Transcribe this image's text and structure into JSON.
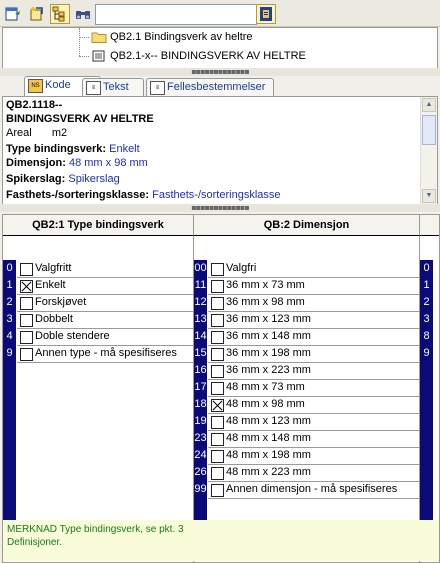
{
  "toolbar": {
    "search_value": "",
    "icons": [
      "new-object-icon",
      "edit-icon",
      "tree-view-icon",
      "binoculars-icon",
      "bookmark-icon"
    ]
  },
  "tree": {
    "items": [
      {
        "label": "QB2.1 Bindingsverk av heltre",
        "icon": "folder-icon"
      },
      {
        "label": "QB2.1-x-- BINDINGSVERK AV HELTRE",
        "icon": "document-icon"
      }
    ]
  },
  "tabs": [
    {
      "label": "Kode",
      "icon": "NS",
      "selected": true
    },
    {
      "label": "Tekst",
      "icon": "doc",
      "selected": false
    },
    {
      "label": "Fellesbestemmelser",
      "icon": "doc",
      "selected": false
    }
  ],
  "info": {
    "code": "QB2.1118--",
    "title": "BINDINGSVERK AV HELTRE",
    "unit_label": "Areal",
    "unit_value": "m2",
    "fields": [
      {
        "label": "Type bindingsverk:",
        "value": "Enkelt"
      },
      {
        "label": "Dimensjon:",
        "value": "48 mm x 98 mm"
      },
      {
        "label": "Spikerslag:",
        "value": "Spikerslag"
      },
      {
        "label": "Fasthets-/sorteringsklasse:",
        "value": "Fasthets-/sorteringsklasse"
      }
    ]
  },
  "columns": [
    {
      "header": "QB2:1 Type bindingsverk",
      "rows": [
        {
          "code": "0",
          "label": "Valgfritt",
          "checked": false
        },
        {
          "code": "1",
          "label": "Enkelt",
          "checked": true
        },
        {
          "code": "2",
          "label": "Forskjøvet",
          "checked": false
        },
        {
          "code": "3",
          "label": "Dobbelt",
          "checked": false
        },
        {
          "code": "4",
          "label": "Doble stendere",
          "checked": false
        },
        {
          "code": "9",
          "label": "Annen type - må spesifiseres",
          "checked": false
        }
      ]
    },
    {
      "header": "QB:2 Dimensjon",
      "rows": [
        {
          "code": "00",
          "label": "Valgfri",
          "checked": false
        },
        {
          "code": "11",
          "label": "36 mm x 73 mm",
          "checked": false
        },
        {
          "code": "12",
          "label": "36 mm x 98 mm",
          "checked": false
        },
        {
          "code": "13",
          "label": "36 mm x 123 mm",
          "checked": false
        },
        {
          "code": "14",
          "label": "36 mm x 148 mm",
          "checked": false
        },
        {
          "code": "15",
          "label": "36 mm x 198 mm",
          "checked": false
        },
        {
          "code": "16",
          "label": "36 mm x 223 mm",
          "checked": false
        },
        {
          "code": "17",
          "label": "48 mm x 73 mm",
          "checked": false
        },
        {
          "code": "18",
          "label": "48 mm x 98 mm",
          "checked": true
        },
        {
          "code": "19",
          "label": "48 mm x 123 mm",
          "checked": false
        },
        {
          "code": "23",
          "label": "48 mm x 148 mm",
          "checked": false
        },
        {
          "code": "24",
          "label": "48 mm x 198 mm",
          "checked": false
        },
        {
          "code": "26",
          "label": "48 mm x 223 mm",
          "checked": false
        },
        {
          "code": "99",
          "label": "Annen dimensjon - må spesifiseres",
          "checked": false
        }
      ]
    },
    {
      "header": "",
      "rows": [
        {
          "code": "0"
        },
        {
          "code": "1"
        },
        {
          "code": "2"
        },
        {
          "code": "3"
        },
        {
          "code": "8"
        },
        {
          "code": "9"
        }
      ]
    }
  ],
  "note": "MERKNAD Type bindingsverk, se pkt. 3 Definisjoner."
}
